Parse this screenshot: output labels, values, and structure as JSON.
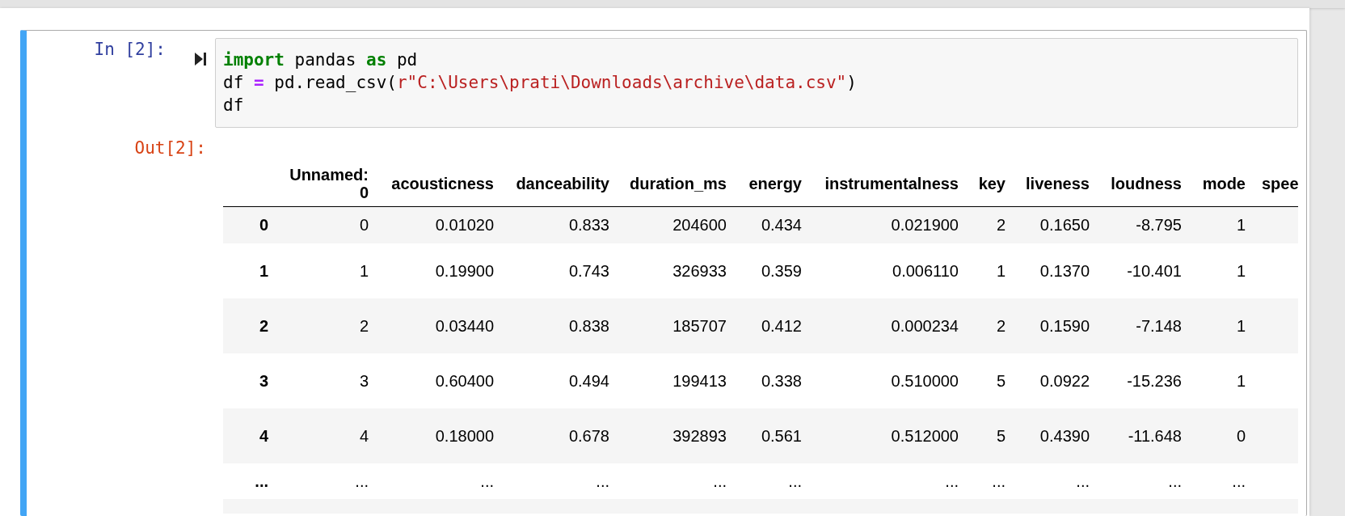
{
  "cell": {
    "input_prompt": "In [2]:",
    "code_lines": [
      [
        {
          "kind": "keyword",
          "text": "import"
        },
        {
          "kind": "plain",
          "text": " pandas "
        },
        {
          "kind": "keyword",
          "text": "as"
        },
        {
          "kind": "plain",
          "text": " pd"
        }
      ],
      [
        {
          "kind": "plain",
          "text": "df "
        },
        {
          "kind": "operator",
          "text": "="
        },
        {
          "kind": "plain",
          "text": " pd.read_csv("
        },
        {
          "kind": "string",
          "text": "r\"C:\\Users\\prati\\Downloads\\archive\\data.csv\""
        },
        {
          "kind": "plain",
          "text": ")"
        }
      ],
      [
        {
          "kind": "plain",
          "text": "df"
        }
      ]
    ],
    "output_prompt": "Out[2]:",
    "table": {
      "columns": [
        "Unnamed: 0",
        "acousticness",
        "danceability",
        "duration_ms",
        "energy",
        "instrumentalness",
        "key",
        "liveness",
        "loudness",
        "mode",
        "spee"
      ],
      "rows": [
        {
          "index": "0",
          "cells": [
            "0",
            "0.01020",
            "0.833",
            "204600",
            "0.434",
            "0.021900",
            "2",
            "0.1650",
            "-8.795",
            "1"
          ]
        },
        {
          "index": "1",
          "cells": [
            "1",
            "0.19900",
            "0.743",
            "326933",
            "0.359",
            "0.006110",
            "1",
            "0.1370",
            "-10.401",
            "1"
          ]
        },
        {
          "index": "2",
          "cells": [
            "2",
            "0.03440",
            "0.838",
            "185707",
            "0.412",
            "0.000234",
            "2",
            "0.1590",
            "-7.148",
            "1"
          ]
        },
        {
          "index": "3",
          "cells": [
            "3",
            "0.60400",
            "0.494",
            "199413",
            "0.338",
            "0.510000",
            "5",
            "0.0922",
            "-15.236",
            "1"
          ]
        },
        {
          "index": "4",
          "cells": [
            "4",
            "0.18000",
            "0.678",
            "392893",
            "0.561",
            "0.512000",
            "5",
            "0.4390",
            "-11.648",
            "0"
          ]
        },
        {
          "index": "...",
          "cells": [
            "...",
            "...",
            "...",
            "...",
            "...",
            "...",
            "...",
            "...",
            "...",
            "..."
          ]
        }
      ]
    }
  }
}
